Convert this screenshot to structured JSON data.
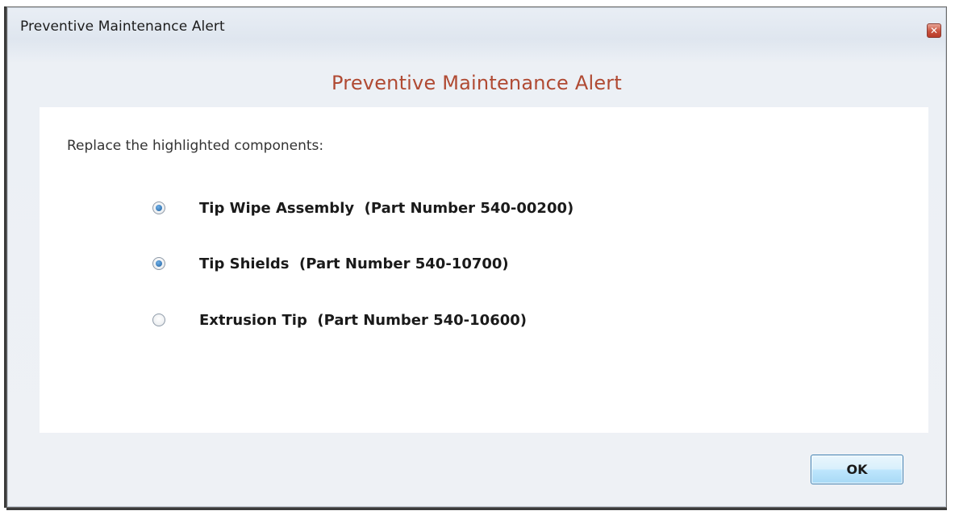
{
  "window": {
    "title": "Preventive Maintenance Alert",
    "close_glyph": "✕"
  },
  "header": {
    "title": "Preventive Maintenance Alert"
  },
  "content": {
    "instruction": "Replace the highlighted components:",
    "options": [
      {
        "label": "Tip Wipe Assembly  (Part Number 540-00200)",
        "checked": true
      },
      {
        "label": "Tip Shields  (Part Number 540-10700)",
        "checked": true
      },
      {
        "label": "Extrusion Tip  (Part Number 540-10600)",
        "checked": false
      }
    ]
  },
  "footer": {
    "ok_label": "OK"
  },
  "colors": {
    "header_title": "#b04a33",
    "panel_background": "#ffffff",
    "radio_selected": "#1f5f9e"
  }
}
